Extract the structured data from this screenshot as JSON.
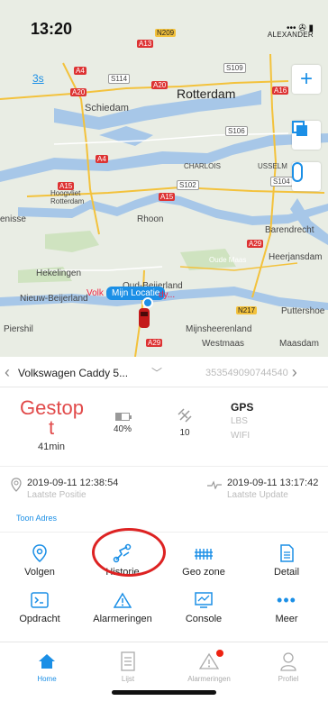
{
  "status_bar": {
    "time": "13:20",
    "carrier": "ALEXANDER",
    "signal": "••• ✇ ▮"
  },
  "map": {
    "refresh_label": "3s",
    "labels": {
      "rotterdam": "Rotterdam",
      "schiedam": "Schiedam",
      "charlois": "CHARLOIS",
      "usselm": "USSELM",
      "hoogvliet": "Hoogvliet\nRotterdam",
      "rhoon": "Rhoon",
      "barendrecht": "Barendrecht",
      "heerjansdam": "Heerjansdam",
      "hekelingen": "Hekelingen",
      "oud_beijerland": "Oud-Beijerland",
      "nieuw_beijerland": "Nieuw-Beijerland",
      "puttershoek": "Puttershoe",
      "piershil": "Piershil",
      "mijnsheerenland": "Mijnsheerenland",
      "westmaas": "Westmaas",
      "maasdam": "Maasdam",
      "enisse": "enisse",
      "oude_maas": "Oude Maas"
    },
    "roads": {
      "a13": "A13",
      "n209": "N209",
      "a4": "A4",
      "s114": "S114",
      "s109": "S109",
      "a20": "A20",
      "a20b": "A20",
      "a16": "A16",
      "s106": "S106",
      "a4b": "A4",
      "a15": "A15",
      "s102": "S102",
      "s104": "S104",
      "a15b": "A15",
      "a29": "A29",
      "n217": "N217",
      "a29b": "A29"
    },
    "car_label": "Volk",
    "car_label_tail": "dy...",
    "location_tag": "Mijn Locatie"
  },
  "vehicle": {
    "name": "Volkswagen Caddy 5...",
    "imei": "353549090744540"
  },
  "status": {
    "state": "Gestop t",
    "duration": "41min",
    "battery_pct": "40%",
    "battery_level": 0.4,
    "satellites": "10",
    "sources": [
      "GPS",
      "LBS",
      "WIFI"
    ],
    "active_source": "GPS"
  },
  "times": {
    "last_position": "2019-09-11 12:38:54",
    "last_position_label": "Laatste Positie",
    "last_update": "2019-09-11 13:17:42",
    "last_update_label": "Laatste Update",
    "show_address": "Toon Adres"
  },
  "actions": [
    {
      "label": "Volgen",
      "icon": "location-pin-icon"
    },
    {
      "label": "Historie",
      "icon": "route-icon"
    },
    {
      "label": "Geo zone",
      "icon": "geofence-icon"
    },
    {
      "label": "Detail",
      "icon": "document-icon"
    },
    {
      "label": "Opdracht",
      "icon": "terminal-icon"
    },
    {
      "label": "Alarmeringen",
      "icon": "warning-icon"
    },
    {
      "label": "Console",
      "icon": "chart-icon"
    },
    {
      "label": "Meer",
      "icon": "more-icon"
    }
  ],
  "tabs": [
    {
      "label": "Home",
      "icon": "home-icon",
      "active": true
    },
    {
      "label": "Lijst",
      "icon": "list-icon",
      "active": false
    },
    {
      "label": "Alarmeringen",
      "icon": "alarm-icon",
      "active": false,
      "badge": true
    },
    {
      "label": "Profiel",
      "icon": "profile-icon",
      "active": false
    }
  ],
  "colors": {
    "accent": "#1b8fe6",
    "stopped": "#e14a4a",
    "highlight_circle": "#dd2222"
  }
}
